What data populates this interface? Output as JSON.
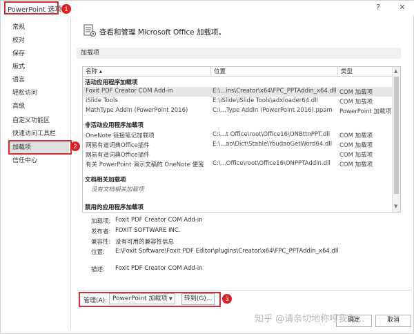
{
  "window": {
    "title": "PowerPoint 选项",
    "help_glyph": "?",
    "close_glyph": "✕"
  },
  "annotations": [
    "1",
    "2",
    "3"
  ],
  "sidebar": {
    "items": [
      {
        "label": "常规"
      },
      {
        "label": "校对"
      },
      {
        "label": "保存"
      },
      {
        "label": "版式"
      },
      {
        "label": "语言"
      },
      {
        "label": "轻松访问"
      },
      {
        "label": "高级"
      },
      {
        "label": "自定义功能区"
      },
      {
        "label": "快速访问工具栏"
      },
      {
        "label": "加载项"
      },
      {
        "label": "信任中心"
      }
    ],
    "active_index": 9
  },
  "main": {
    "heading": "查看和管理 Microsoft Office 加载项。",
    "section_label": "加载项",
    "table": {
      "columns": [
        "名称 ▴",
        "位置",
        "类型"
      ],
      "groups": [
        {
          "title": "活动应用程序加载项",
          "rows": [
            {
              "name": "Foxit PDF Creator COM Add-in",
              "location": "E:\\...ins\\Creator\\x64\\FPC_PPTAddin_x64.dll",
              "type": "COM 加载项",
              "selected": true
            },
            {
              "name": "iSlide Tools",
              "location": "E:\\iSlide\\iSlide Tools\\adxloader64.dll",
              "type": "COM 加载项"
            },
            {
              "name": "MathType AddIn (PowerPoint 2016)",
              "location": "C:\\...Type AddIn (PowerPoint 2016).ppam",
              "type": "PowerPoint 加载项"
            }
          ]
        },
        {
          "title": "非活动应用程序加载项",
          "rows": [
            {
              "name": "OneNote 链接笔记加载项",
              "location": "C:\\...t Office\\root\\Office16\\ONBttnPPT.dll",
              "type": "COM 加载项"
            },
            {
              "name": "网易有道词典Office插件",
              "location": "E:\\...ao\\Dict\\Stable\\YoudaoGetWord64.dll",
              "type": "COM 加载项"
            },
            {
              "name": "网易有道词典Office插件",
              "location": "",
              "type": "COM 加载项"
            },
            {
              "name": "有关 PowerPoint 演示文稿的 OneNote 便笺",
              "location": "C:\\...Office\\root\\Office16\\ONPPTAddin.dll",
              "type": "COM 加载项"
            }
          ]
        },
        {
          "title": "文档相关加载项",
          "empty_note": "没有文档相关加载项",
          "rows": []
        },
        {
          "title": "禁用的应用程序加载项",
          "rows": []
        }
      ]
    },
    "details": [
      {
        "label": "加载项:",
        "value": "Foxit PDF Creator COM Add-in"
      },
      {
        "label": "发布者:",
        "value": "FOXIT SOFTWARE INC."
      },
      {
        "label": "兼容性:",
        "value": "没有可用的兼容性信息"
      },
      {
        "label": "位置:",
        "value": "E:\\Foxit Software\\Foxit PDF Editor\\plugins\\Creator\\x64\\FPC_PPTAddin_x64.dll"
      },
      {
        "label": "描述:",
        "value": "Foxit PDF Creator COM Add-in"
      }
    ],
    "manage": {
      "label": "管理(A):",
      "selected": "PowerPoint 加载项",
      "go_button": "转到(G)..."
    }
  },
  "footer": {
    "ok_button": "确定",
    "cancel_button": "取消"
  },
  "watermark": "知乎 @请亲切地称呼我为..."
}
